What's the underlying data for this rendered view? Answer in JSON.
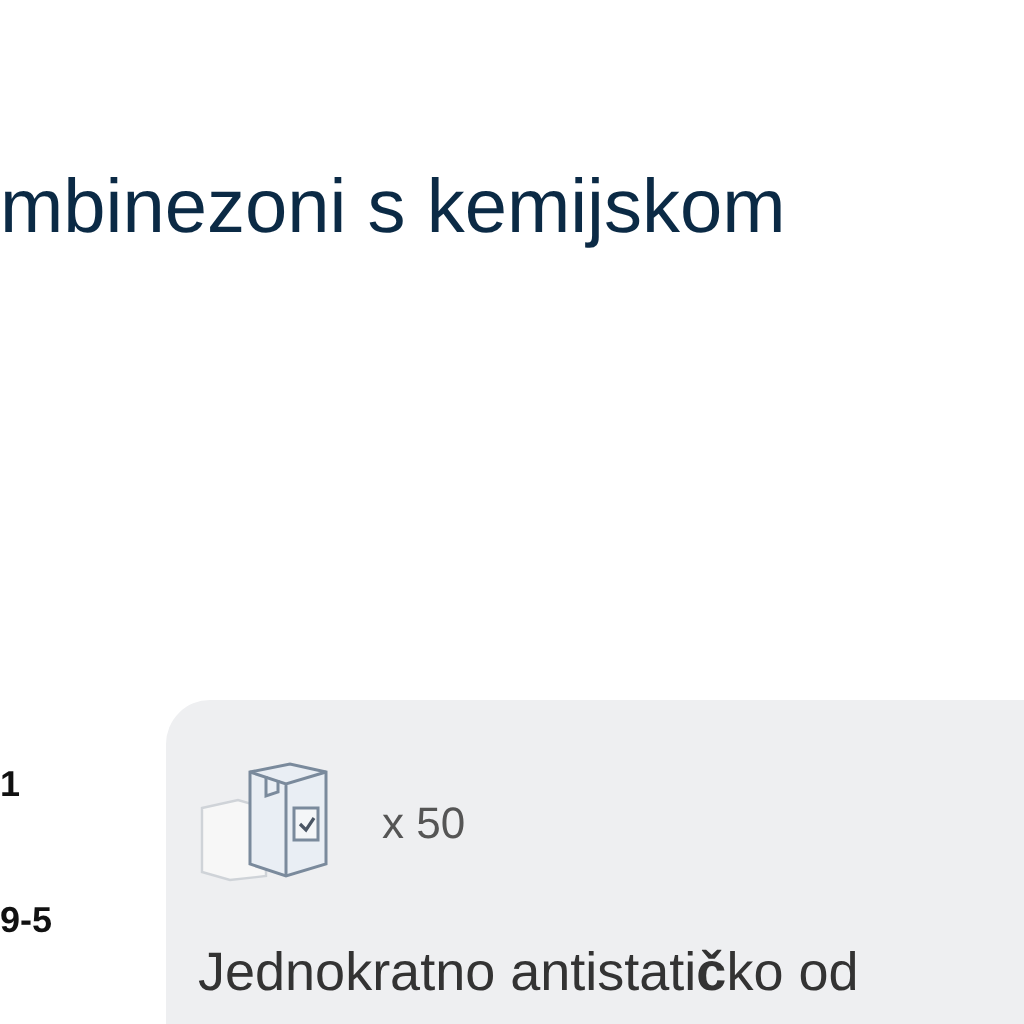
{
  "heading": "mbinezoni s kemijskom",
  "side_labels": [
    "1",
    "9-5"
  ],
  "card": {
    "quantity": "x 50",
    "description": "Jednokratno antistati**č**ko od"
  }
}
